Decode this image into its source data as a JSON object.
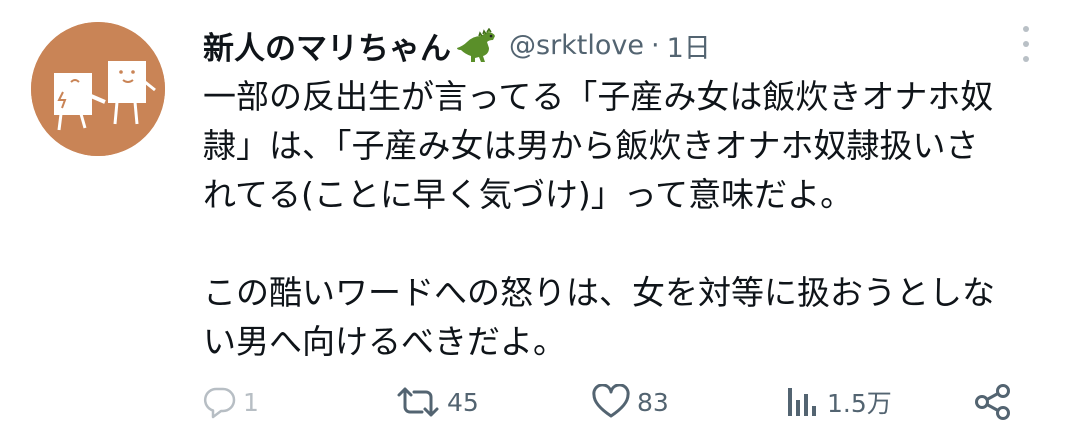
{
  "user": {
    "display_name": "新人のマリちゃん",
    "handle": "@srktlove",
    "separator": "·",
    "time": "1日"
  },
  "tweet": {
    "lines": [
      "一部の反出生が言ってる「子産み女は飯炊きオナホ奴",
      "隷」は、「子産み女は男から飯炊きオナホ奴隷扱いさ",
      "れてる(ことに早く気づけ)」って意味だよ。",
      "",
      "この酷いワードへの怒りは、女を対等に扱おうとしな",
      "い男へ向けるべきだよ。"
    ]
  },
  "actions": {
    "reply_count": "1",
    "retweet_count": "45",
    "like_count": "83",
    "views_count": "1.5万"
  },
  "icons": {
    "reply": "reply-icon",
    "retweet": "retweet-icon",
    "like": "heart-icon",
    "views": "views-icon",
    "share": "share-icon",
    "more": "more-icon",
    "emoji": "dinosaur-emoji"
  },
  "colors": {
    "avatar_bg": "#c98456",
    "text": "#0f1419",
    "secondary": "#536471"
  }
}
